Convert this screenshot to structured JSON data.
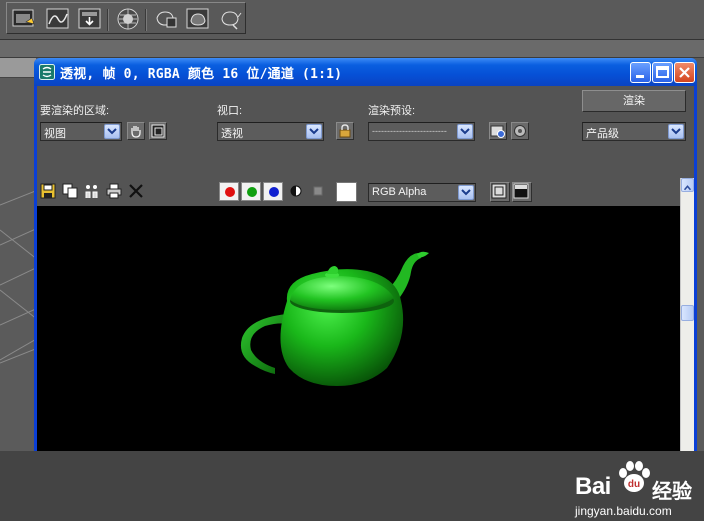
{
  "main_toolbar": {
    "icons": [
      "render-setup-icon",
      "material-editor-icon",
      "render-frame-icon",
      "environment-icon",
      "render-iterative-icon",
      "render-teapot-icon",
      "quick-render-icon"
    ]
  },
  "window": {
    "title": "透视, 帧 0, RGBA 颜色 16 位/通道 (1:1)",
    "title_icon": "3ds-max-icon",
    "buttons": [
      "minimize",
      "maximize",
      "close"
    ]
  },
  "controls": {
    "area_label": "要渲染的区域:",
    "area_value": "视图",
    "viewport_label": "视口:",
    "viewport_value": "透视",
    "preset_label": "渲染预设:",
    "preset_value": "-------------------------",
    "render_button": "渲染",
    "quality_value": "产品级"
  },
  "image_toolbar": {
    "channel_colors": {
      "red": "#e01010",
      "green": "#10a010",
      "blue": "#1020d0"
    },
    "display_channel": "RGB Alpha",
    "swatch_color": "#ffffff"
  },
  "render_image": {
    "subject": "teapot",
    "teapot_color": "#1ec21e",
    "background_color": "#000000"
  },
  "watermark": {
    "brand": "Bai",
    "brand_tail": "经验",
    "url": "jingyan.baidu.com"
  }
}
